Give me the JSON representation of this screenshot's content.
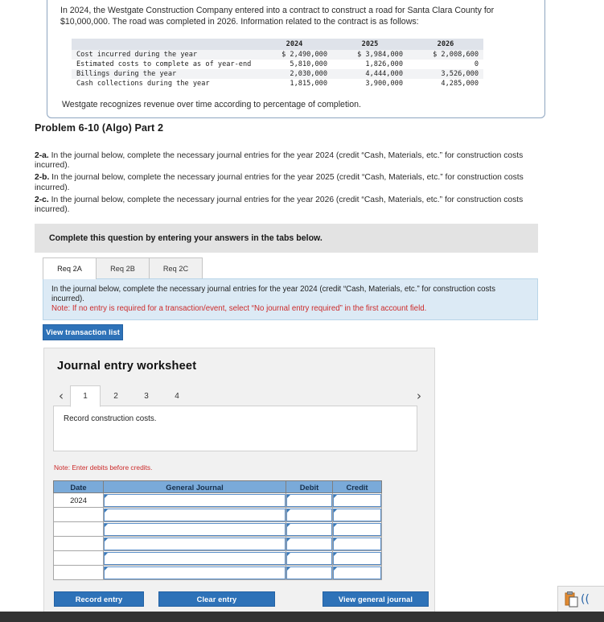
{
  "problem_statement": {
    "paragraph": "In 2024, the Westgate Construction Company entered into a contract to construct a road for Santa Clara County for $10,000,000. The road was completed in 2026. Information related to the contract is as follows:",
    "table": {
      "row_header_label": "",
      "columns": [
        "2024",
        "2025",
        "2026"
      ],
      "rows": [
        {
          "label": "Cost incurred during the year",
          "values": [
            "$ 2,490,000",
            "$ 3,984,000",
            "$ 2,008,600"
          ]
        },
        {
          "label": "Estimated costs to complete as of year-end",
          "values": [
            "5,810,000",
            "1,826,000",
            "0"
          ]
        },
        {
          "label": "Billings during the year",
          "values": [
            "2,030,000",
            "4,444,000",
            "3,526,000"
          ]
        },
        {
          "label": "Cash collections during the year",
          "values": [
            "1,815,000",
            "3,900,000",
            "4,285,000"
          ]
        }
      ]
    },
    "footnote": "Westgate recognizes revenue over time according to percentage of completion."
  },
  "problem_title": "Problem 6-10 (Algo) Part 2",
  "requirements": [
    {
      "tag": "2-a.",
      "text": " In the journal below, complete the necessary journal entries for the year 2024 (credit “Cash, Materials, etc.” for construction costs incurred)."
    },
    {
      "tag": "2-b.",
      "text": " In the journal below, complete the necessary journal entries for the year 2025 (credit “Cash, Materials, etc.” for construction costs incurred)."
    },
    {
      "tag": "2-c.",
      "text": " In the journal below, complete the necessary journal entries for the year 2026 (credit “Cash, Materials, etc.” for construction costs incurred)."
    }
  ],
  "banner": {
    "text": "Complete this question by entering your answers in the tabs below."
  },
  "tabs": [
    {
      "label": "Req 2A",
      "active": true
    },
    {
      "label": "Req 2B",
      "active": false
    },
    {
      "label": "Req 2C",
      "active": false
    }
  ],
  "instruction": {
    "main": "In the journal below, complete the necessary journal entries for the year 2024 (credit “Cash, Materials, etc.” for construction costs incurred).",
    "note": "Note: If no entry is required for a transaction/event, select “No journal entry required” in the first account field."
  },
  "buttons": {
    "view_transaction_list": "View transaction list",
    "record_entry": "Record entry",
    "clear_entry": "Clear entry",
    "view_general_journal": "View general journal"
  },
  "worksheet": {
    "title": "Journal entry worksheet",
    "pager": {
      "prev_icon": "chevron-left",
      "next_icon": "chevron-right",
      "pages": [
        "1",
        "2",
        "3",
        "4"
      ],
      "active_page": "1"
    },
    "description": "Record construction costs.",
    "note": "Note: Enter debits before credits.",
    "journal_table": {
      "columns": [
        "Date",
        "General Journal",
        "Debit",
        "Credit"
      ],
      "rows": [
        {
          "date": "2024",
          "general_journal": "",
          "debit": "",
          "credit": ""
        },
        {
          "date": "",
          "general_journal": "",
          "debit": "",
          "credit": ""
        },
        {
          "date": "",
          "general_journal": "",
          "debit": "",
          "credit": ""
        },
        {
          "date": "",
          "general_journal": "",
          "debit": "",
          "credit": ""
        },
        {
          "date": "",
          "general_journal": "",
          "debit": "",
          "credit": ""
        },
        {
          "date": "",
          "general_journal": "",
          "debit": "",
          "credit": ""
        }
      ]
    }
  },
  "clipboard_widget": {
    "icon": "clipboard-paste-icon",
    "paren": "(("
  },
  "colors": {
    "accent_blue": "#2e72b8",
    "table_header_blue": "#7aaad9",
    "instruction_bg": "#dceaf5",
    "note_red": "#cc2b2b",
    "banner_grey": "#e3e3e3"
  }
}
